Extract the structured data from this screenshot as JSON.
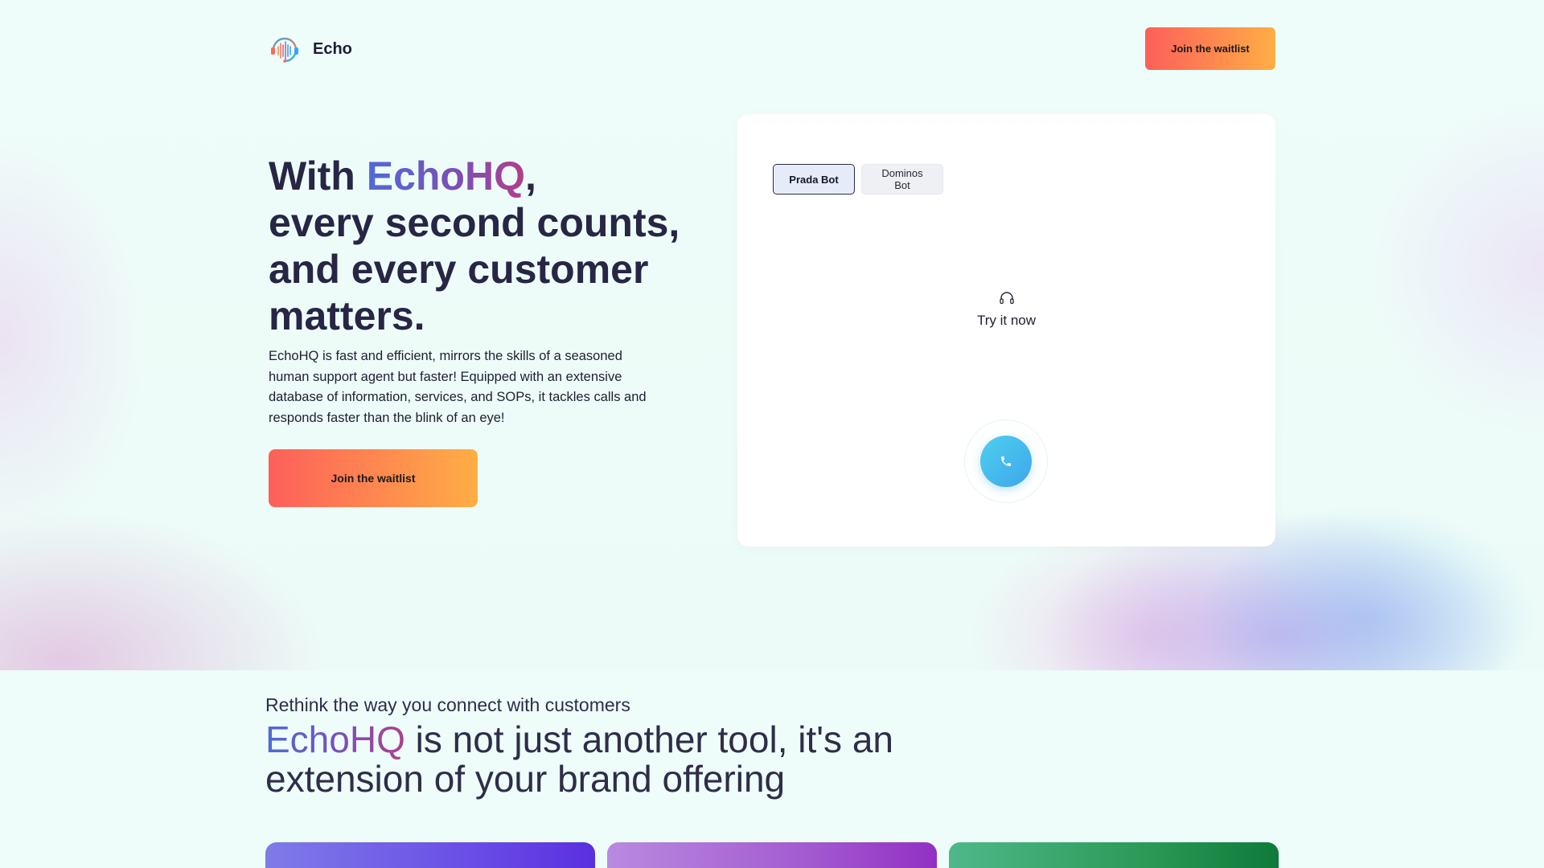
{
  "header": {
    "brand": "Echo",
    "logo_icon": "audio-wave-headset-icon",
    "cta_label": "Join the waitlist"
  },
  "hero": {
    "title_prefix": "With ",
    "title_brand": "EchoHQ",
    "title_suffix": ",\nevery second counts, and every customer matters.",
    "description": "EchoHQ is fast and efficient, mirrors the skills of a seasoned human support agent but faster! Equipped with an extensive database of information, services, and SOPs, it tackles calls and responds faster than the blink of an eye!",
    "cta_label": "Join the waitlist"
  },
  "demo": {
    "tabs": [
      {
        "label": "Prada Bot",
        "active": true
      },
      {
        "label": "Dominos Bot",
        "active": false
      }
    ],
    "try_icon": "headset-icon",
    "try_label": "Try it now",
    "call_icon": "phone-icon"
  },
  "section": {
    "subtitle": "Rethink the way you connect with customers",
    "title_brand": "EchoHQ",
    "title_rest": " is not just another tool, it's an extension of your brand offering"
  },
  "colors": {
    "cta_gradient_start": "#fd5f5a",
    "cta_gradient_end": "#ffae45",
    "brand_gradient_start": "#4f6ad9",
    "brand_gradient_end": "#b13f8a",
    "call_button": "#3ea6ec",
    "text_dark": "#272645"
  }
}
